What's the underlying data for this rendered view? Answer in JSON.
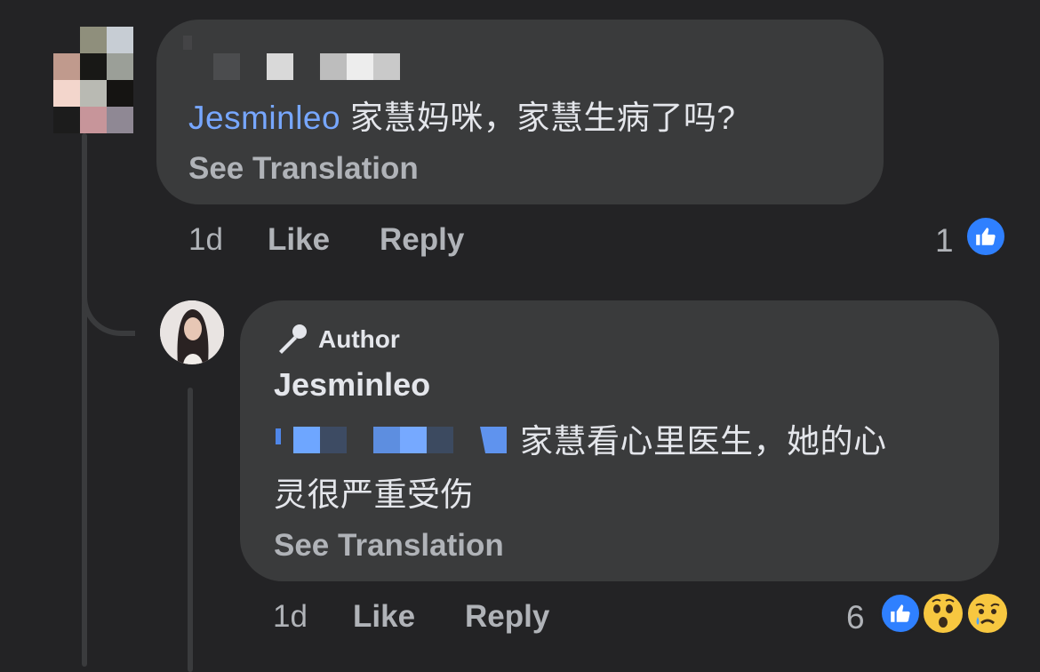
{
  "comment1": {
    "mention": "Jesminleo",
    "text": "家慧妈咪，家慧生病了吗?",
    "see_translation": "See Translation",
    "time": "1d",
    "like_label": "Like",
    "reply_label": "Reply",
    "reaction_count": "1",
    "reactions": [
      "like-icon"
    ]
  },
  "comment2": {
    "badge": "Author",
    "badge_icon": "microphone-icon",
    "author_name": "Jesminleo",
    "text_line1": "家慧看心里医生，她的心",
    "text_line2": "灵很严重受伤",
    "see_translation": "See Translation",
    "time": "1d",
    "like_label": "Like",
    "reply_label": "Reply",
    "reaction_count": "6",
    "reactions": [
      "like-icon",
      "wow-icon",
      "sad-icon"
    ]
  },
  "colors": {
    "background": "#232325",
    "bubble": "#3a3b3c",
    "mention": "#77a7ff",
    "like_blue": "#2f80ff",
    "secondary_text": "#b0b3b8"
  }
}
